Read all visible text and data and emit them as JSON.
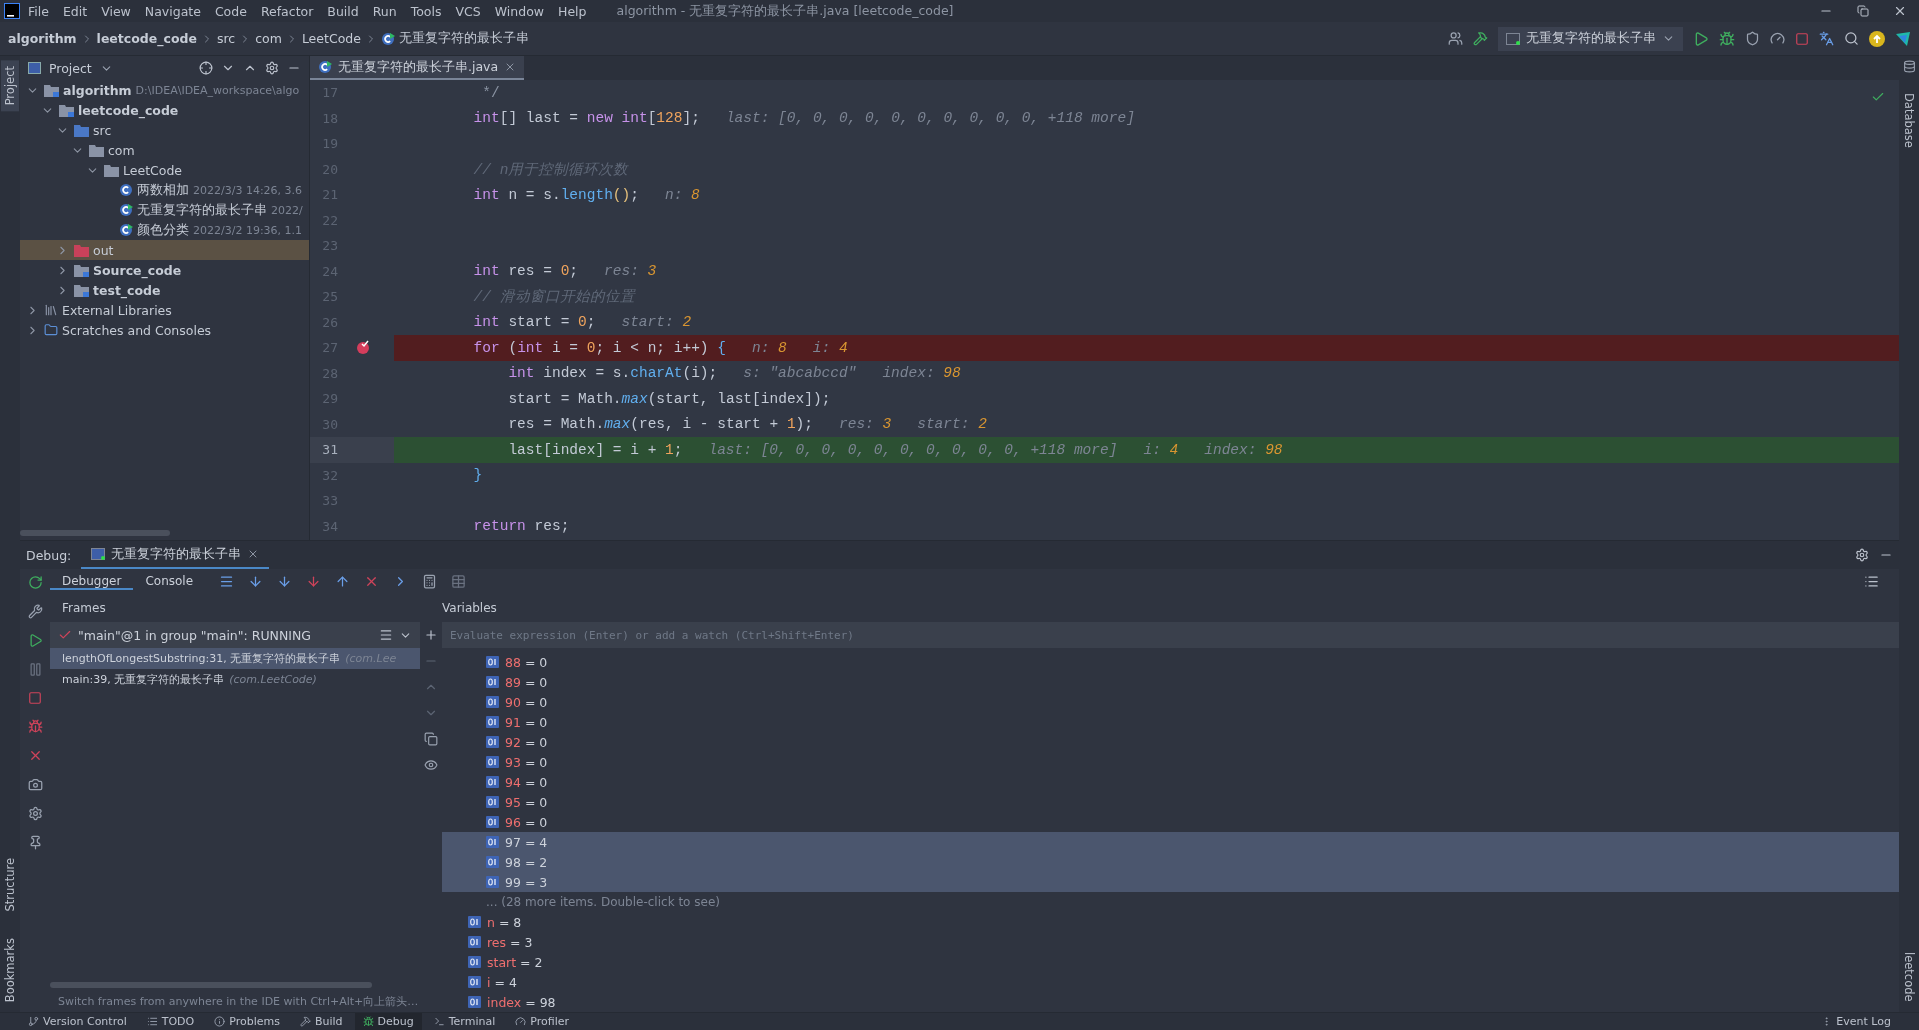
{
  "menu": {
    "items": [
      "File",
      "Edit",
      "View",
      "Navigate",
      "Code",
      "Refactor",
      "Build",
      "Run",
      "Tools",
      "VCS",
      "Window",
      "Help"
    ],
    "title": "algorithm - 无重复字符的最长子串.java [leetcode_code]"
  },
  "breadcrumbs": [
    {
      "label": "algorithm",
      "kind": "module"
    },
    {
      "label": "leetcode_code",
      "kind": "module"
    },
    {
      "label": "src",
      "kind": "folder"
    },
    {
      "label": "com",
      "kind": "folder"
    },
    {
      "label": "LeetCode",
      "kind": "folder"
    },
    {
      "label": "无重复字符的最长子串",
      "kind": "class"
    }
  ],
  "run_config": "无重复字符的最长子串",
  "left_stripe": {
    "top": [
      {
        "label": "Project",
        "selected": true
      }
    ],
    "bottom": [
      {
        "label": "Structure",
        "selected": false
      },
      {
        "label": "Bookmarks",
        "selected": false
      }
    ]
  },
  "right_stripe": {
    "top": [
      "Database"
    ],
    "bottom": [
      "leetcode"
    ]
  },
  "project": {
    "title": "Project",
    "tree": [
      {
        "label": "algorithm",
        "kind": "module",
        "meta": "D:\\IDEA\\IDEA_workspace\\algo",
        "expanded": true,
        "selected": false,
        "children": [
          {
            "label": "leetcode_code",
            "kind": "module",
            "expanded": true,
            "selected": false,
            "children": [
              {
                "label": "src",
                "kind": "source",
                "expanded": true,
                "selected": false,
                "children": [
                  {
                    "label": "com",
                    "kind": "package",
                    "expanded": true,
                    "selected": false,
                    "children": [
                      {
                        "label": "LeetCode",
                        "kind": "package",
                        "expanded": true,
                        "selected": false,
                        "children": [
                          {
                            "label": "两数相加",
                            "kind": "class",
                            "meta": "2022/3/3 14:26, 3.6",
                            "selected": false
                          },
                          {
                            "label": "无重复字符的最长子串",
                            "kind": "runnable",
                            "meta": "2022/",
                            "selected": false
                          },
                          {
                            "label": "颜色分类",
                            "kind": "runnable",
                            "meta": "2022/3/2 19:36, 1.1",
                            "selected": false
                          }
                        ]
                      }
                    ]
                  }
                ]
              },
              {
                "label": "out",
                "kind": "excluded",
                "expanded": false,
                "selected": true
              },
              {
                "label": "Source_code",
                "kind": "module",
                "expanded": false,
                "selected": false
              },
              {
                "label": "test_code",
                "kind": "module",
                "expanded": false,
                "selected": false
              }
            ]
          }
        ]
      },
      {
        "label": "External Libraries",
        "kind": "libraries",
        "expanded": false,
        "selected": false
      },
      {
        "label": "Scratches and Consoles",
        "kind": "scratches",
        "expanded": false,
        "selected": false
      }
    ]
  },
  "editor": {
    "tab": "无重复字符的最长子串.java",
    "lines": [
      {
        "no": "17",
        "kind": "plain",
        "tokens": [
          {
            "kind": "doc",
            "t": "         */"
          }
        ]
      },
      {
        "no": "18",
        "kind": "plain",
        "tokens": [
          {
            "kind": "keyword",
            "t": "        int"
          },
          {
            "kind": "identifier",
            "t": "[] last = "
          },
          {
            "kind": "keyword",
            "t": "new int"
          },
          {
            "kind": "identifier",
            "t": "["
          },
          {
            "kind": "number",
            "t": "128"
          },
          {
            "kind": "identifier",
            "t": "];"
          }
        ],
        "hints": [
          {
            "label": "last:",
            "value": "[0, 0, 0, 0, 0, 0, 0, 0, 0, 0, +118 more]",
            "kind": "array"
          }
        ]
      },
      {
        "no": "19",
        "kind": "plain"
      },
      {
        "no": "20",
        "kind": "plain",
        "tokens": [
          {
            "kind": "comment",
            "t": "        // n用于控制循环次数"
          }
        ]
      },
      {
        "no": "21",
        "kind": "plain",
        "tokens": [
          {
            "kind": "keyword",
            "t": "        int"
          },
          {
            "kind": "identifier",
            "t": " n = s."
          },
          {
            "kind": "method",
            "t": "length"
          },
          {
            "kind": "paren",
            "t": "()"
          },
          {
            "kind": "identifier",
            "t": ";"
          }
        ],
        "hints": [
          {
            "label": "n:",
            "value": "8",
            "kind": "number"
          }
        ]
      },
      {
        "no": "22",
        "kind": "plain"
      },
      {
        "no": "23",
        "kind": "plain"
      },
      {
        "no": "24",
        "kind": "plain",
        "tokens": [
          {
            "kind": "keyword",
            "t": "        int"
          },
          {
            "kind": "identifier",
            "t": " res = "
          },
          {
            "kind": "number",
            "t": "0"
          },
          {
            "kind": "identifier",
            "t": ";"
          }
        ],
        "hints": [
          {
            "label": "res:",
            "value": "3",
            "kind": "number"
          }
        ]
      },
      {
        "no": "25",
        "kind": "plain",
        "tokens": [
          {
            "kind": "comment",
            "t": "        // 滑动窗口开始的位置"
          }
        ]
      },
      {
        "no": "26",
        "kind": "plain",
        "tokens": [
          {
            "kind": "keyword",
            "t": "        int"
          },
          {
            "kind": "identifier",
            "t": " start = "
          },
          {
            "kind": "number",
            "t": "0"
          },
          {
            "kind": "identifier",
            "t": ";"
          }
        ],
        "hints": [
          {
            "label": "start:",
            "value": "2",
            "kind": "number"
          }
        ]
      },
      {
        "no": "27",
        "kind": "breakpoint",
        "tokens": [
          {
            "kind": "keyword",
            "t": "        for"
          },
          {
            "kind": "identifier",
            "t": " ("
          },
          {
            "kind": "keyword",
            "t": "int"
          },
          {
            "kind": "identifier",
            "t": " i = "
          },
          {
            "kind": "number",
            "t": "0"
          },
          {
            "kind": "identifier",
            "t": "; i < n; i++) "
          },
          {
            "kind": "brace",
            "t": "{"
          }
        ],
        "hints": [
          {
            "label": "n:",
            "value": "8",
            "kind": "number"
          },
          {
            "label": "i:",
            "value": "4",
            "kind": "number"
          }
        ]
      },
      {
        "no": "28",
        "kind": "plain",
        "tokens": [
          {
            "kind": "keyword",
            "t": "            int"
          },
          {
            "kind": "identifier",
            "t": " index = s."
          },
          {
            "kind": "method",
            "t": "charAt"
          },
          {
            "kind": "identifier",
            "t": "(i);"
          }
        ],
        "hints": [
          {
            "label": "s:",
            "value": "\"abcabccd\"",
            "kind": "string"
          },
          {
            "label": "index:",
            "value": "98",
            "kind": "number"
          }
        ]
      },
      {
        "no": "29",
        "kind": "plain",
        "tokens": [
          {
            "kind": "identifier",
            "t": "            start = Math."
          },
          {
            "kind": "static",
            "t": "max"
          },
          {
            "kind": "identifier",
            "t": "(start, last[index]);"
          }
        ]
      },
      {
        "no": "30",
        "kind": "plain",
        "tokens": [
          {
            "kind": "identifier",
            "t": "            res = Math."
          },
          {
            "kind": "static",
            "t": "max"
          },
          {
            "kind": "identifier",
            "t": "(res, i - start + "
          },
          {
            "kind": "number",
            "t": "1"
          },
          {
            "kind": "identifier",
            "t": ");"
          }
        ],
        "hints": [
          {
            "label": "res:",
            "value": "3",
            "kind": "number"
          },
          {
            "label": "start:",
            "value": "2",
            "kind": "number"
          }
        ]
      },
      {
        "no": "31",
        "kind": "execution",
        "tokens": [
          {
            "kind": "identifier",
            "t": "            last[index] = i + "
          },
          {
            "kind": "number",
            "t": "1"
          },
          {
            "kind": "identifier",
            "t": ";"
          }
        ],
        "hints": [
          {
            "label": "last:",
            "value": "[0, 0, 0, 0, 0, 0, 0, 0, 0, 0, +118 more]",
            "kind": "array"
          },
          {
            "label": "i:",
            "value": "4",
            "kind": "number"
          },
          {
            "label": "index:",
            "value": "98",
            "kind": "number"
          }
        ]
      },
      {
        "no": "32",
        "kind": "plain",
        "tokens": [
          {
            "kind": "brace",
            "t": "        }"
          }
        ]
      },
      {
        "no": "33",
        "kind": "plain"
      },
      {
        "no": "34",
        "kind": "plain",
        "tokens": [
          {
            "kind": "keyword",
            "t": "        return"
          },
          {
            "kind": "identifier",
            "t": " res;"
          }
        ]
      }
    ]
  },
  "debug": {
    "label": "Debug:",
    "session": "无重复字符的最长子串",
    "tabs": [
      {
        "label": "Debugger",
        "selected": true
      },
      {
        "label": "Console",
        "selected": false
      }
    ],
    "frames": {
      "title": "Frames",
      "thread": "\"main\"@1 in group \"main\": RUNNING",
      "items": [
        {
          "method": "lengthOfLongestSubstring:31, 无重复字符的最长子串",
          "pkg": "(com.Lee",
          "selected": true
        },
        {
          "method": "main:39, 无重复字符的最长子串",
          "pkg": "(com.LeetCode)",
          "selected": false
        }
      ],
      "tip": "Switch frames from anywhere in the IDE with Ctrl+Alt+向上箭头…"
    },
    "variables": {
      "title": "Variables",
      "placeholder": "Evaluate expression (Enter) or add a watch (Ctrl+Shift+Enter)",
      "elements": [
        {
          "name": "88",
          "value": "= 0",
          "selected": false
        },
        {
          "name": "89",
          "value": "= 0",
          "selected": false
        },
        {
          "name": "90",
          "value": "= 0",
          "selected": false
        },
        {
          "name": "91",
          "value": "= 0",
          "selected": false
        },
        {
          "name": "92",
          "value": "= 0",
          "selected": false
        },
        {
          "name": "93",
          "value": "= 0",
          "selected": false
        },
        {
          "name": "94",
          "value": "= 0",
          "selected": false
        },
        {
          "name": "95",
          "value": "= 0",
          "selected": false
        },
        {
          "name": "96",
          "value": "= 0",
          "selected": false
        },
        {
          "name": "97",
          "value": "= 4",
          "selected": true
        },
        {
          "name": "98",
          "value": "= 2",
          "selected": true
        },
        {
          "name": "99",
          "value": "= 3",
          "selected": true
        }
      ],
      "more": "... (28 more items. Double-click to see)",
      "locals": [
        {
          "name": "n",
          "value": "= 8",
          "selected": false
        },
        {
          "name": "res",
          "value": "= 3",
          "selected": false
        },
        {
          "name": "start",
          "value": "= 2",
          "selected": false
        },
        {
          "name": "i",
          "value": "= 4",
          "selected": false
        },
        {
          "name": "index",
          "value": "= 98",
          "selected": false
        }
      ]
    }
  },
  "status_bar": {
    "tools": [
      {
        "label": "Version Control",
        "kind": "vcs",
        "selected": false
      },
      {
        "label": "TODO",
        "kind": "todo",
        "selected": false
      },
      {
        "label": "Problems",
        "kind": "problems",
        "selected": false
      },
      {
        "label": "Build",
        "kind": "build",
        "selected": false
      },
      {
        "label": "Debug",
        "kind": "debug",
        "selected": true
      },
      {
        "label": "Terminal",
        "kind": "terminal",
        "selected": false
      },
      {
        "label": "Profiler",
        "kind": "profiler",
        "selected": false
      }
    ],
    "right": "Event Log"
  }
}
